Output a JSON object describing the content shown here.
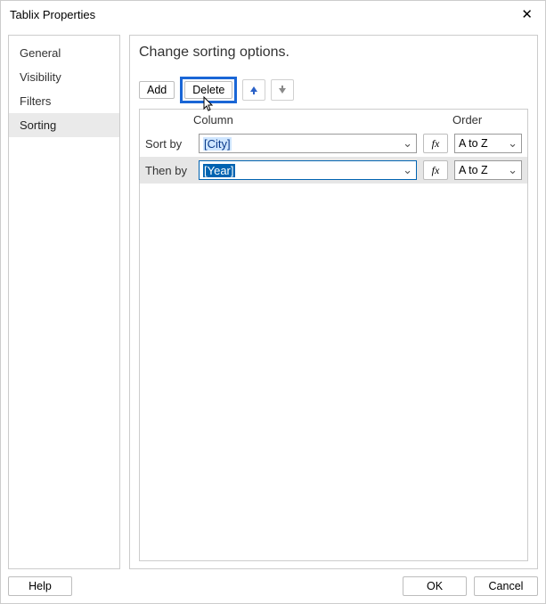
{
  "window": {
    "title": "Tablix Properties",
    "close": "✕"
  },
  "sidebar": {
    "items": [
      {
        "label": "General"
      },
      {
        "label": "Visibility"
      },
      {
        "label": "Filters"
      },
      {
        "label": "Sorting"
      }
    ]
  },
  "main": {
    "heading": "Change sorting options.",
    "toolbar": {
      "add": "Add",
      "delete": "Delete"
    },
    "grid": {
      "header_column": "Column",
      "header_order": "Order",
      "rows": [
        {
          "label": "Sort by",
          "value": "[City]",
          "expr": "fx",
          "order": "A to Z"
        },
        {
          "label": "Then by",
          "value": "[Year]",
          "expr": "fx",
          "order": "A to Z"
        }
      ]
    }
  },
  "footer": {
    "help": "Help",
    "ok": "OK",
    "cancel": "Cancel"
  }
}
